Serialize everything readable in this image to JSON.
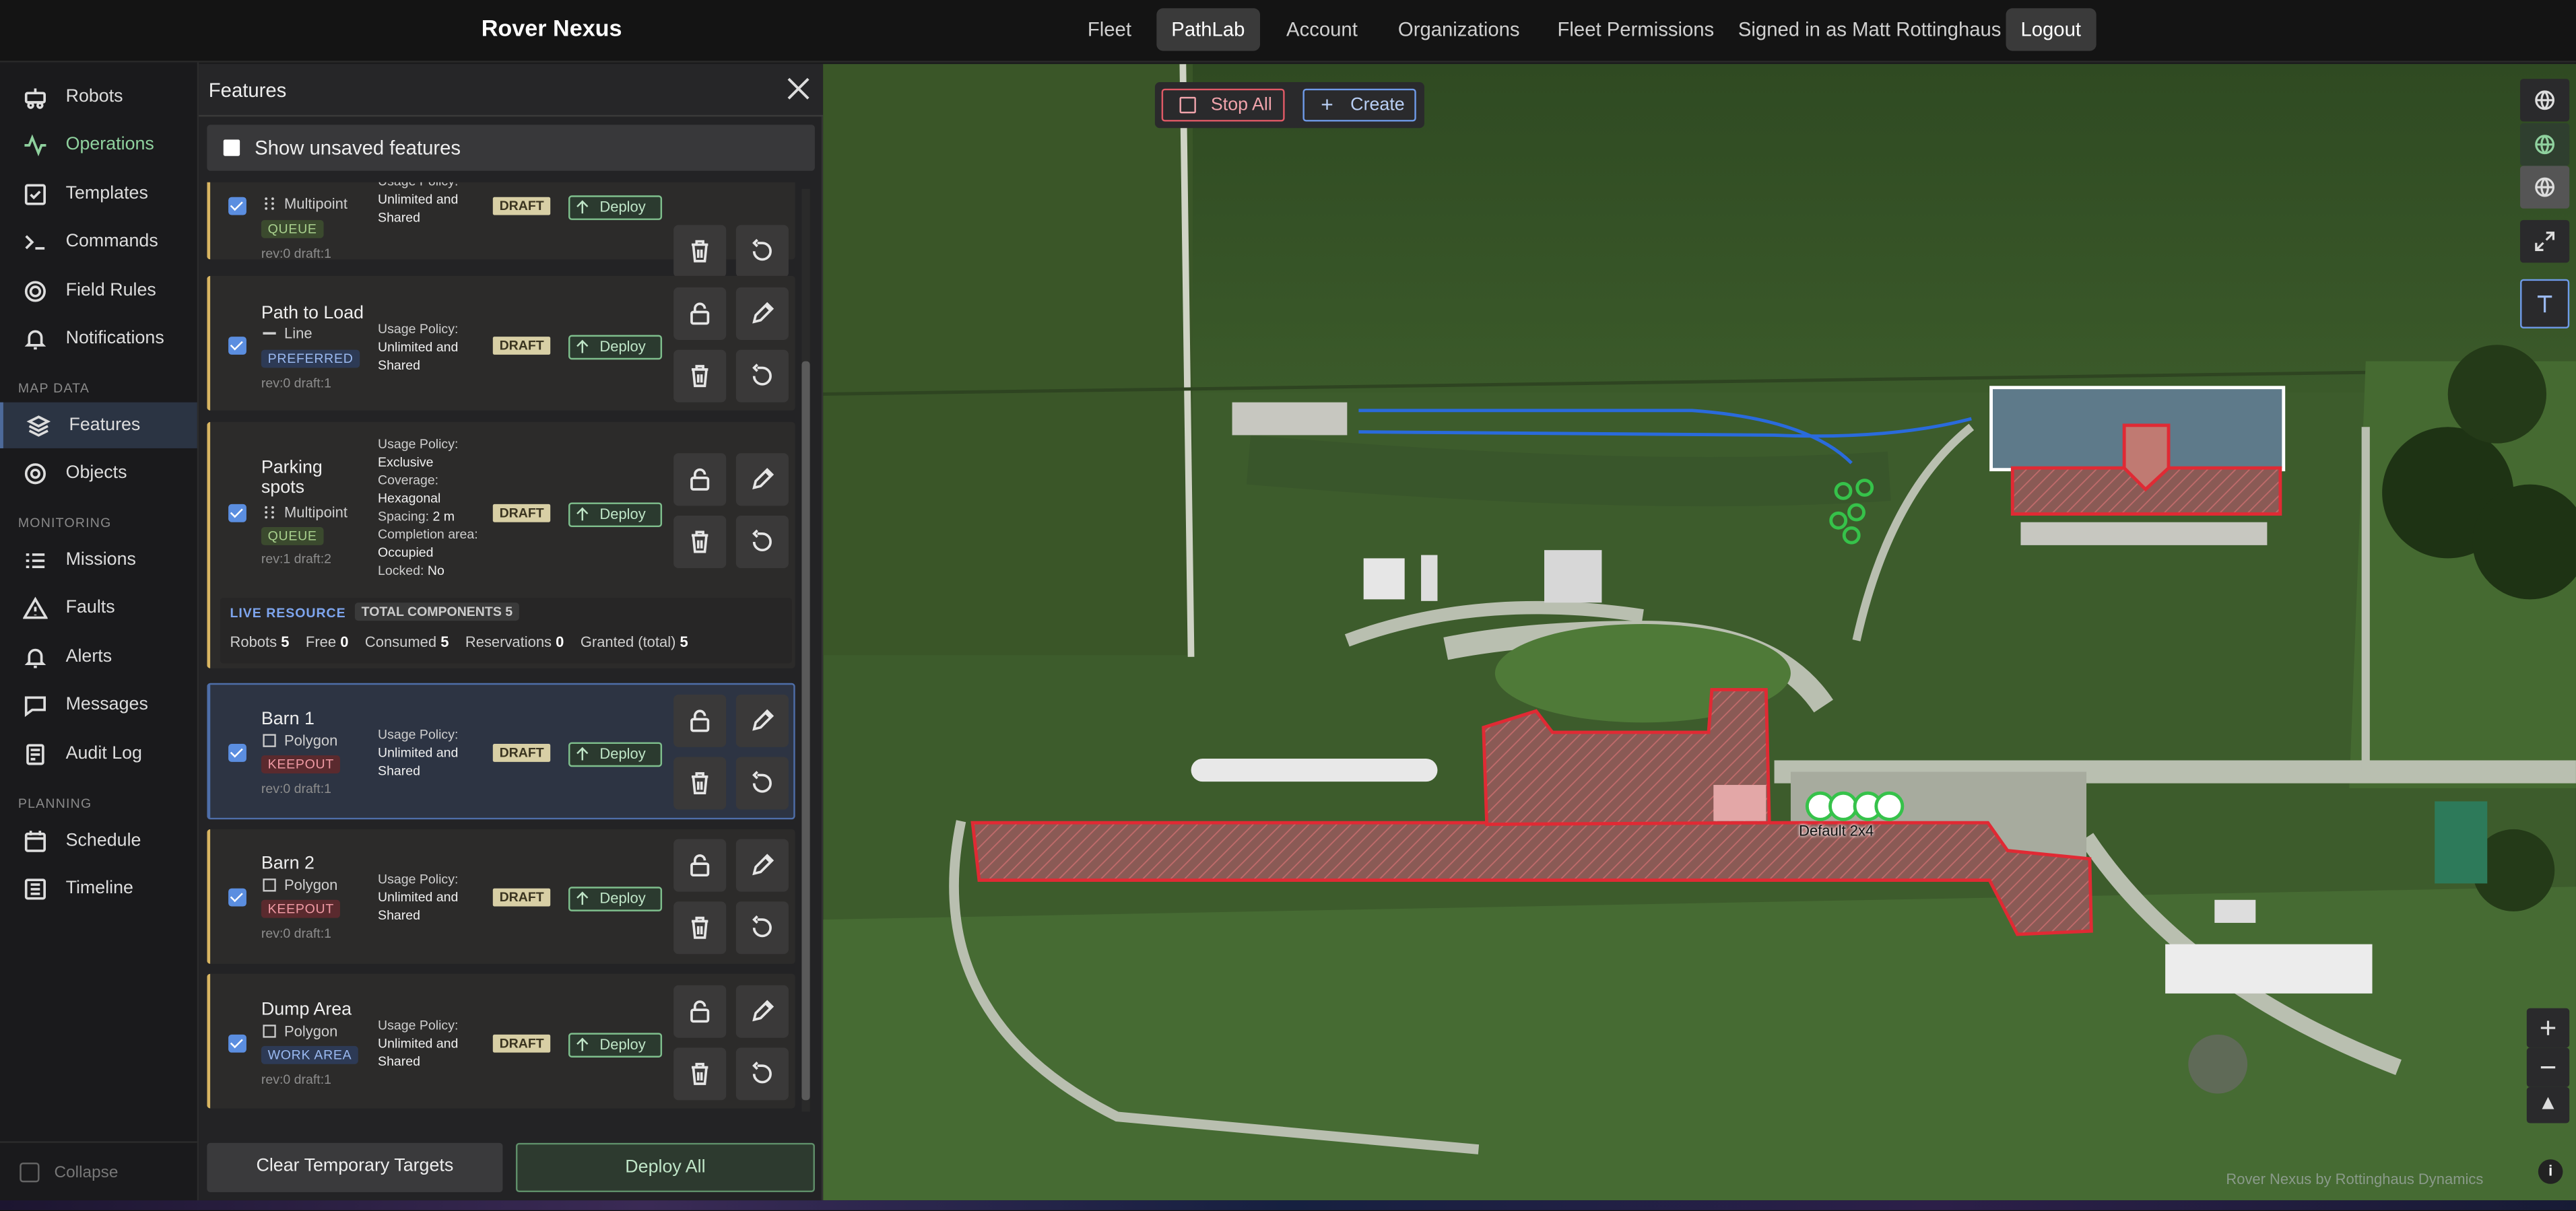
{
  "app": {
    "title": "Rover Nexus"
  },
  "topnav": {
    "items": [
      "Fleet",
      "PathLab",
      "Account",
      "Organizations",
      "Fleet Permissions"
    ],
    "active": "PathLab",
    "signed_in": "Signed in as Matt Rottinghaus",
    "logout": "Logout"
  },
  "sidebar": {
    "items": [
      {
        "label": "Robots",
        "icon": "robot-icon"
      },
      {
        "label": "Operations",
        "icon": "activity-icon"
      },
      {
        "label": "Templates",
        "icon": "checklist-icon"
      },
      {
        "label": "Commands",
        "icon": "terminal-icon"
      },
      {
        "label": "Field Rules",
        "icon": "target-icon"
      },
      {
        "label": "Notifications",
        "icon": "bell-icon"
      },
      {
        "label": "Features",
        "icon": "layers-icon"
      },
      {
        "label": "Objects",
        "icon": "circles-icon"
      },
      {
        "label": "Missions",
        "icon": "list-icon"
      },
      {
        "label": "Faults",
        "icon": "warning-icon"
      },
      {
        "label": "Alerts",
        "icon": "bell-icon"
      },
      {
        "label": "Messages",
        "icon": "message-icon"
      },
      {
        "label": "Audit Log",
        "icon": "log-icon"
      },
      {
        "label": "Schedule",
        "icon": "calendar-icon"
      },
      {
        "label": "Timeline",
        "icon": "timeline-icon"
      }
    ],
    "sections": [
      "MAP DATA",
      "MONITORING",
      "PLANNING"
    ],
    "collapse": "Collapse",
    "active": "Features"
  },
  "panel": {
    "title": "Features",
    "show_unsaved": "Show unsaved features",
    "usage_label": "Usage Policy:",
    "draft": "DRAFT",
    "deploy": "Deploy",
    "features": [
      {
        "name": "",
        "type": "Multipoint",
        "tag": "QUEUE",
        "rev": "rev:0 draft:1",
        "policy": "Unlimited and Shared"
      },
      {
        "name": "Path to Load",
        "type": "Line",
        "tag": "PREFERRED",
        "rev": "rev:0 draft:1",
        "policy": "Unlimited and Shared"
      },
      {
        "name": "Parking spots",
        "type": "Multipoint",
        "tag": "QUEUE",
        "rev": "rev:1 draft:2",
        "policy": "Exclusive",
        "coverage": "Hexagonal",
        "spacing": "2 m",
        "completion": "Occupied",
        "locked": "No"
      },
      {
        "name": "Barn 1",
        "type": "Polygon",
        "tag": "KEEPOUT",
        "rev": "rev:0 draft:1",
        "policy": "Unlimited and Shared"
      },
      {
        "name": "Barn 2",
        "type": "Polygon",
        "tag": "KEEPOUT",
        "rev": "rev:0 draft:1",
        "policy": "Unlimited and Shared"
      },
      {
        "name": "Dump Area",
        "type": "Polygon",
        "tag": "WORK AREA",
        "rev": "rev:0 draft:1",
        "policy": "Unlimited and Shared"
      }
    ],
    "labels": {
      "coverage": "Coverage:",
      "spacing": "Spacing:",
      "completion": "Completion area:",
      "locked": "Locked:"
    },
    "live": {
      "title": "LIVE RESOURCE",
      "total": "TOTAL COMPONENTS 5",
      "robots_label": "Robots",
      "robots": "5",
      "free_label": "Free",
      "free": "0",
      "consumed_label": "Consumed",
      "consumed": "5",
      "reservations_label": "Reservations",
      "reservations": "0",
      "granted_label": "Granted (total)",
      "granted": "5"
    },
    "clear_button": "Clear Temporary Targets",
    "deploy_all": "Deploy All"
  },
  "map": {
    "stop_all": "Stop All",
    "create": "Create",
    "point_label": "Default 2x4",
    "attribution": "Rover Nexus by Rottinghaus Dynamics",
    "colors": {
      "keepout": "#e02a34",
      "path": "#2a6bdc",
      "points": "#36c24a",
      "workarea": "#ffffff"
    }
  }
}
